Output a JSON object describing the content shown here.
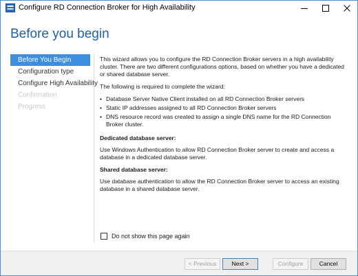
{
  "window": {
    "title": "Configure RD Connection Broker for High Availability",
    "controls": {
      "minimize_icon": "minimize-icon",
      "maximize_icon": "maximize-icon",
      "close_icon": "close-icon"
    }
  },
  "page": {
    "title": "Before you begin"
  },
  "sidebar": {
    "items": [
      {
        "label": "Before You Begin",
        "state": "selected"
      },
      {
        "label": "Configuration type",
        "state": "enabled"
      },
      {
        "label": "Configure High Availability",
        "state": "enabled"
      },
      {
        "label": "Confirmation",
        "state": "disabled"
      },
      {
        "label": "Progress",
        "state": "disabled"
      }
    ]
  },
  "content": {
    "intro": "This wizard allows you to configure the RD Connection Broker servers in a high availability cluster. There are two different configurations options, based on whether you have a dedicated or shared database server.",
    "required_intro": "The following is required to complete the wizard:",
    "requirements": [
      "Database Server Native Client installed on all RD Connection Broker servers",
      "Static IP addresses assigned to all RD Connection Broker servers",
      "DNS resource record was created to assign a single DNS name for the RD Connection Broker cluster."
    ],
    "dedicated_heading": "Dedicated database server:",
    "dedicated_text": "Use Windows Authentication to allow RD Connection Broker server to create and access a database in a dedicated database server.",
    "shared_heading": "Shared database server:",
    "shared_text": "Use database authentication to allow the RD Connection Broker server to access an existing database in a shared database server."
  },
  "checkbox": {
    "label": "Do not show this page again",
    "checked": false
  },
  "footer": {
    "previous": "< Previous",
    "next": "Next >",
    "configure": "Configure",
    "cancel": "Cancel"
  },
  "colors": {
    "accent": "#3c8fde",
    "title_blue": "#1e5fa8",
    "window_border": "#4a8dd6",
    "footer_bg": "#f0f0f0"
  }
}
